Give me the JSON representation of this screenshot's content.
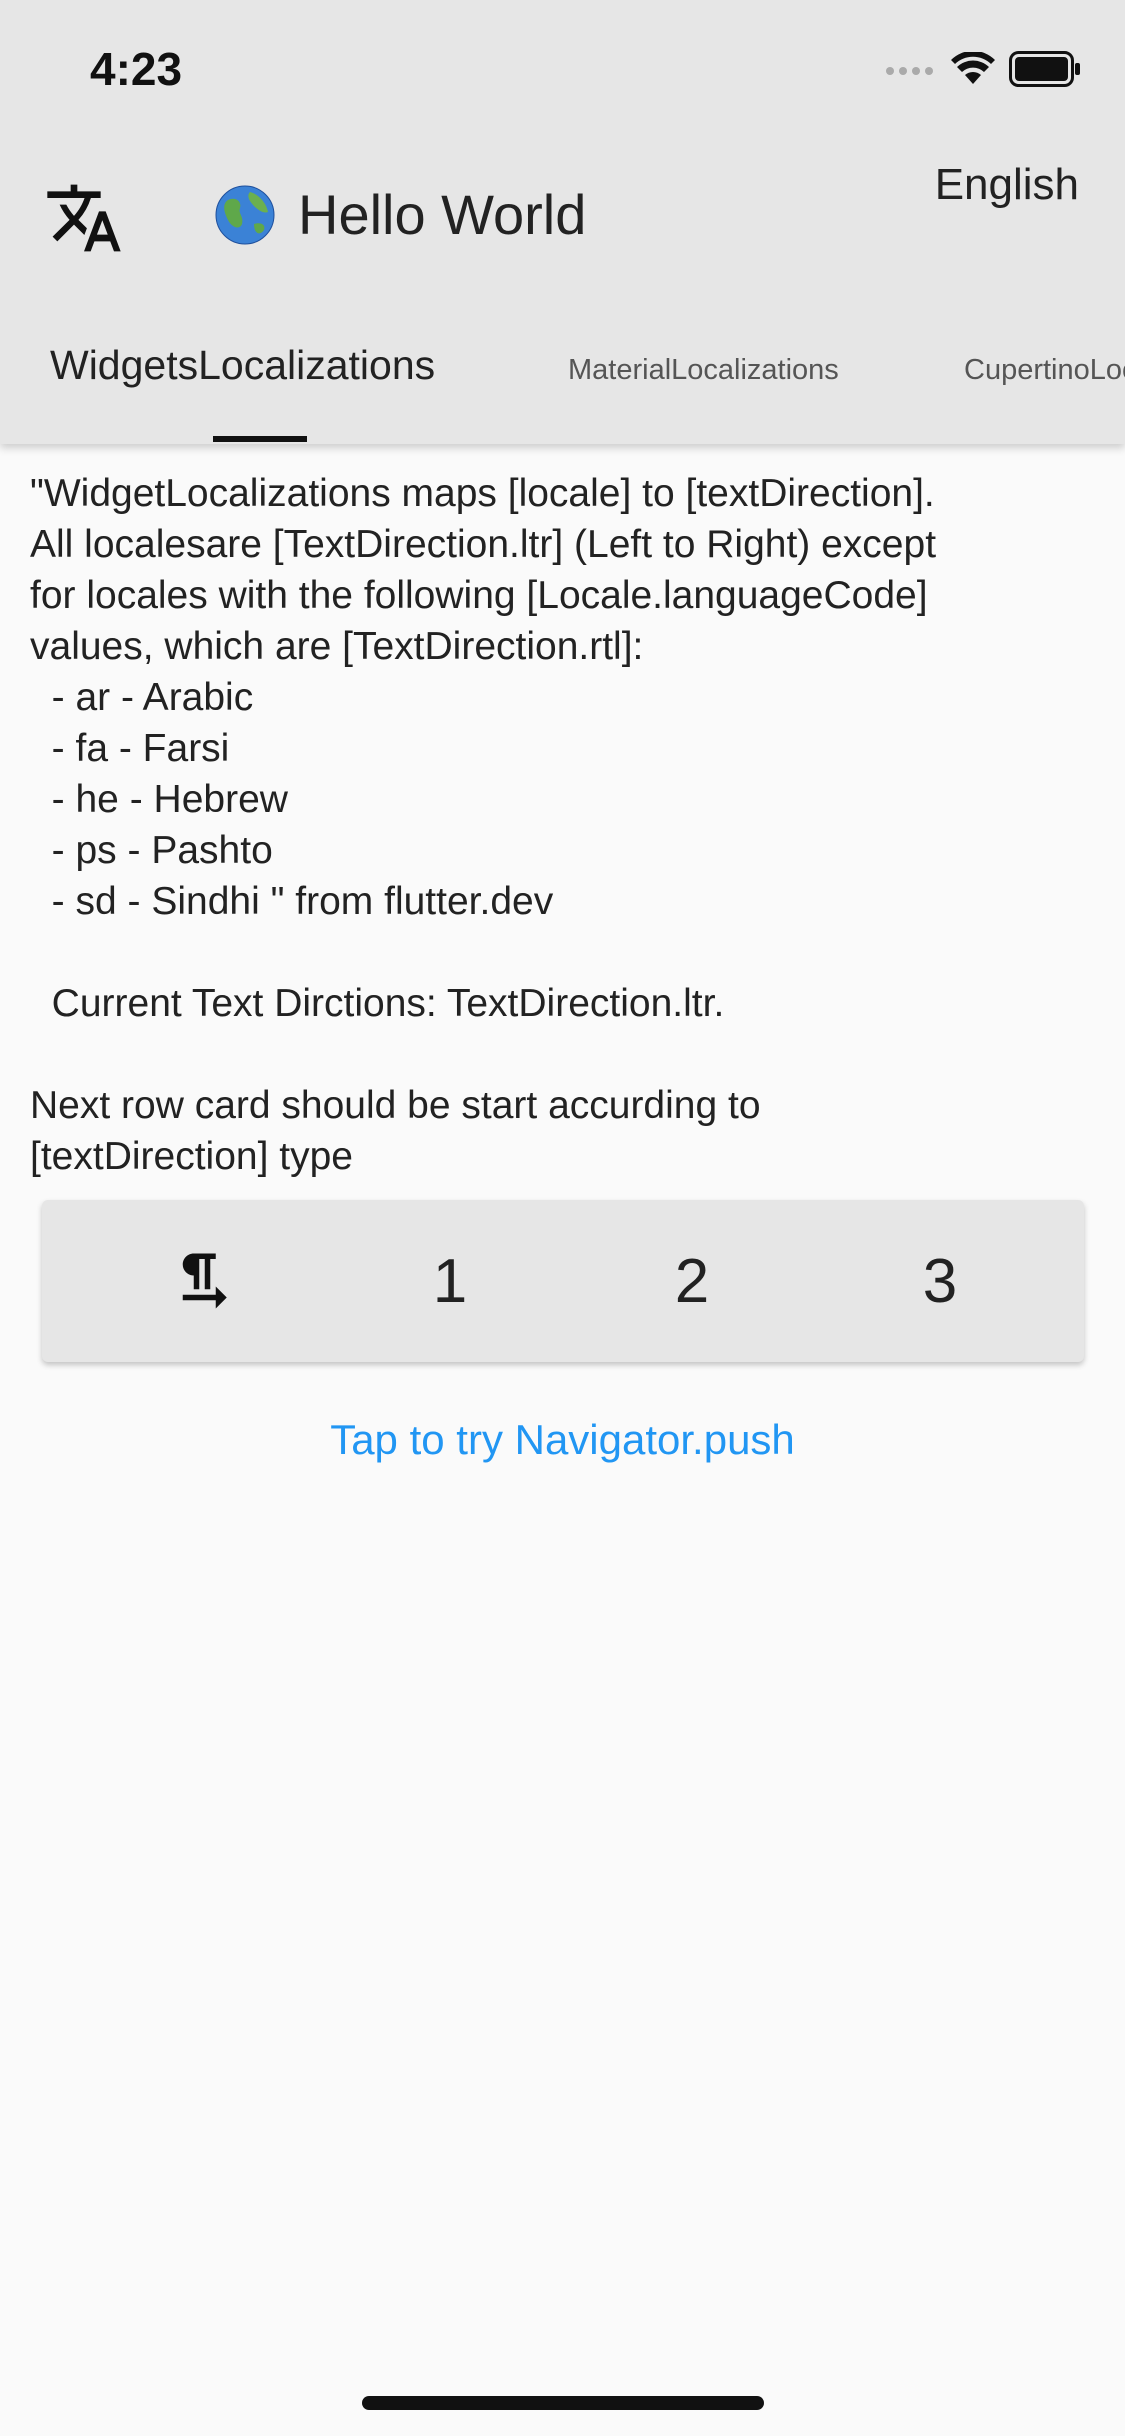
{
  "status_bar": {
    "time": "4:23",
    "icons": [
      "signal-icon",
      "wifi-icon",
      "battery-icon"
    ]
  },
  "app_bar": {
    "leading_icon": "translate-icon",
    "title_icon": "globe-emoji",
    "title": "Hello World",
    "language_label": "English",
    "background": "#e6e6e6"
  },
  "tabs": [
    {
      "label": "WidgetsLocalizations",
      "active": true
    },
    {
      "label": "MaterialLocalizations",
      "active": false
    },
    {
      "label": "CupertinoLocalizations",
      "active": false
    }
  ],
  "content": {
    "description": "\"WidgetLocalizations maps [locale] to [textDirection].\nAll localesare [TextDirection.ltr] (Left to Right) except\nfor locales with the following [Locale.languageCode]\nvalues, which are [TextDirection.rtl]:\n  - ar - Arabic\n  - fa - Farsi\n  - he - Hebrew\n  - ps - Pashto\n  - sd - Sindhi \" from flutter.dev",
    "current_direction": "  Current Text Dirctions: TextDirection.ltr.",
    "next_row_note": "Next row card should be start accurding to\n[textDirection] type"
  },
  "card": {
    "icon": "format-textdirection-l-to-r-icon",
    "items": [
      "1",
      "2",
      "3"
    ]
  },
  "navigator_link": {
    "label": "Tap to try Navigator.push",
    "color": "#2196f3"
  }
}
